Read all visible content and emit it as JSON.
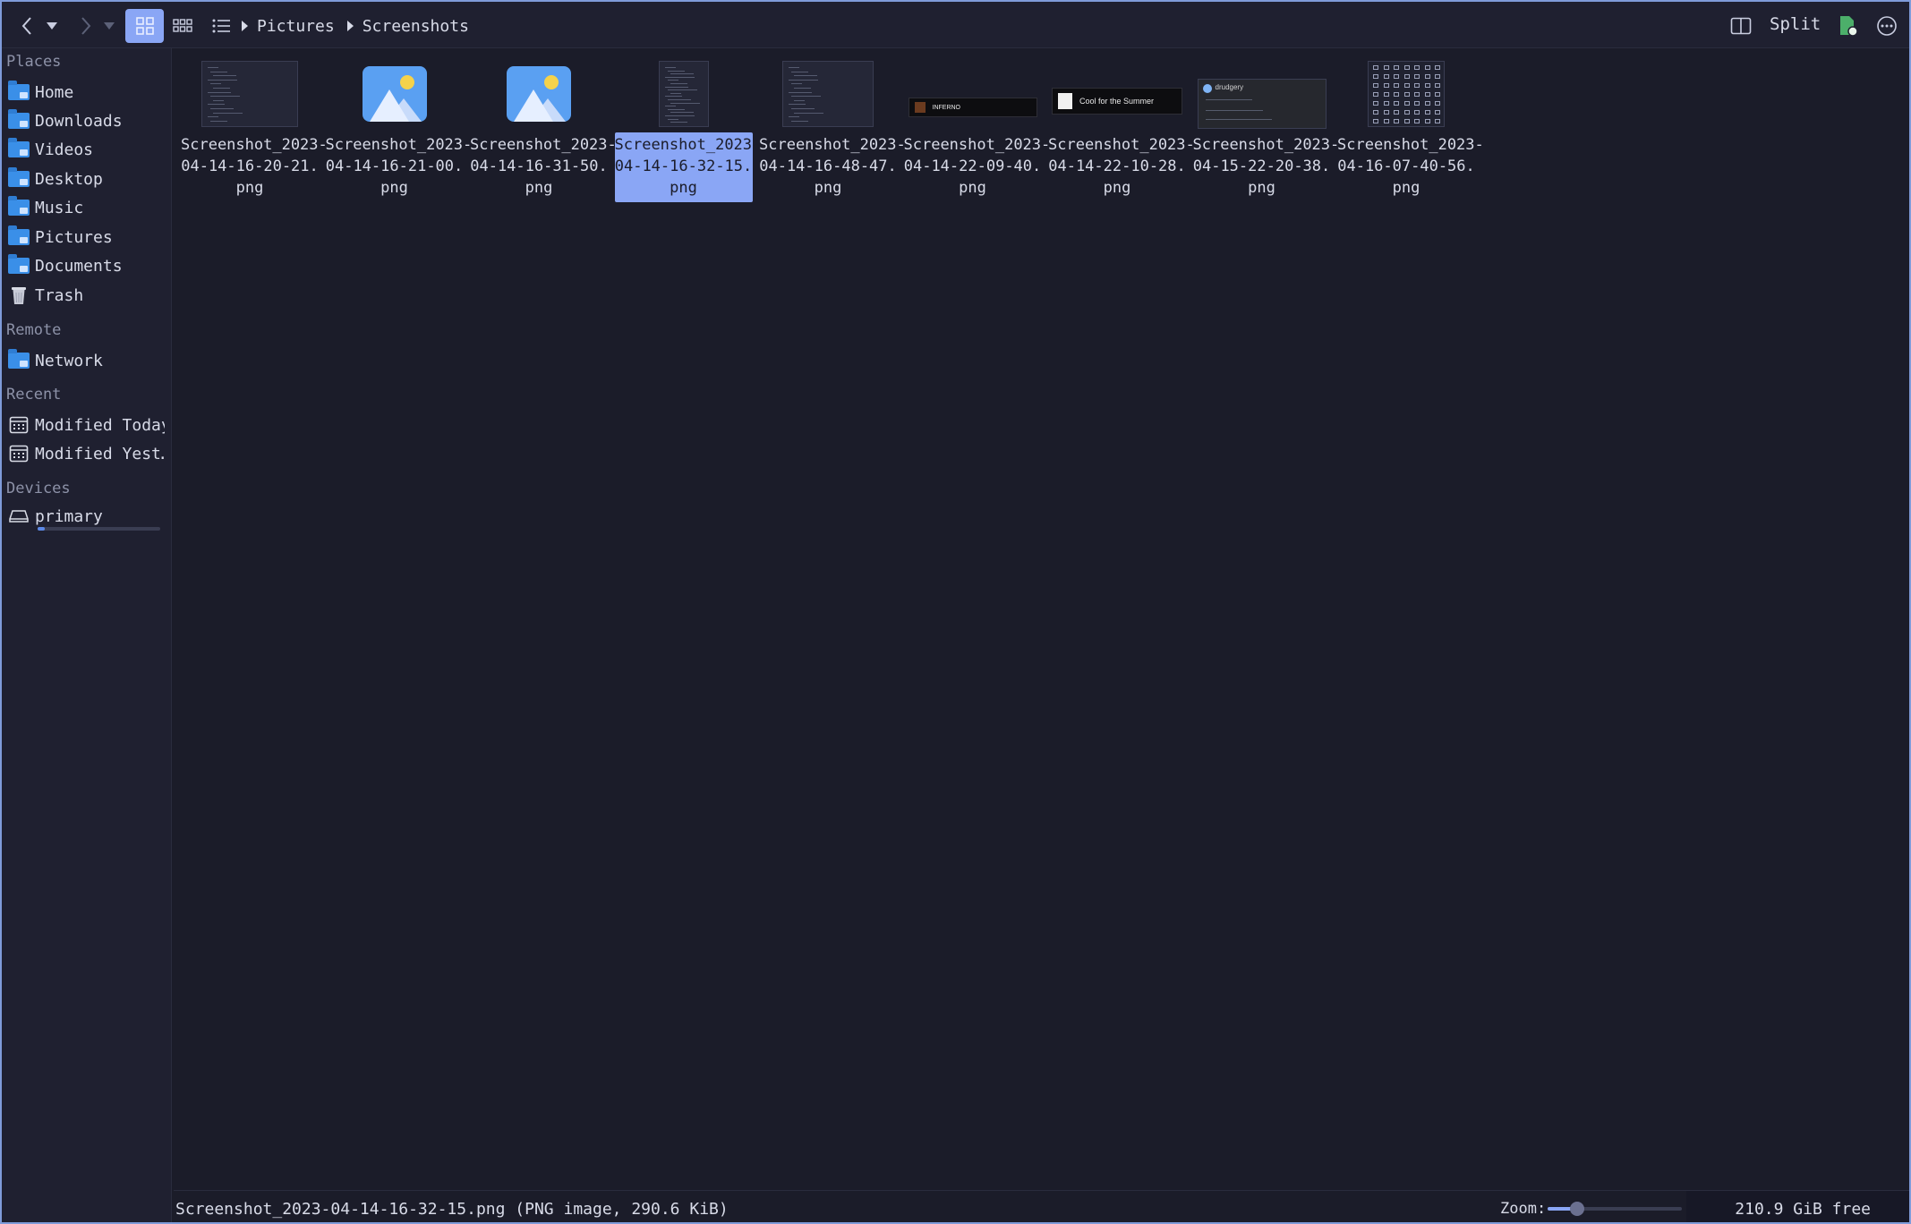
{
  "breadcrumb": [
    "Pictures",
    "Screenshots"
  ],
  "toolbar": {
    "split_label": "Split"
  },
  "sidebar": {
    "sections": [
      {
        "title": "Places",
        "items": [
          {
            "label": "Home",
            "icon": "home-folder-icon"
          },
          {
            "label": "Downloads",
            "icon": "downloads-folder-icon"
          },
          {
            "label": "Videos",
            "icon": "videos-folder-icon"
          },
          {
            "label": "Desktop",
            "icon": "desktop-folder-icon"
          },
          {
            "label": "Music",
            "icon": "music-folder-icon"
          },
          {
            "label": "Pictures",
            "icon": "pictures-folder-icon"
          },
          {
            "label": "Documents",
            "icon": "documents-folder-icon"
          },
          {
            "label": "Trash",
            "icon": "trash-icon"
          }
        ]
      },
      {
        "title": "Remote",
        "items": [
          {
            "label": "Network",
            "icon": "network-folder-icon"
          }
        ]
      },
      {
        "title": "Recent",
        "items": [
          {
            "label": "Modified Today",
            "icon": "calendar-icon"
          },
          {
            "label": "Modified Yest…",
            "icon": "calendar-icon"
          }
        ]
      },
      {
        "title": "Devices",
        "items": [
          {
            "label": "primary",
            "icon": "drive-icon",
            "usage_fraction": 0.06
          }
        ]
      }
    ]
  },
  "files": [
    {
      "line1": "Screenshot_2023-",
      "line2": "04-14-16-20-21.",
      "line3": "png",
      "thumb": "screenshot"
    },
    {
      "line1": "Screenshot_2023-",
      "line2": "04-14-16-21-00.",
      "line3": "png",
      "thumb": "image-icon"
    },
    {
      "line1": "Screenshot_2023-",
      "line2": "04-14-16-31-50.",
      "line3": "png",
      "thumb": "image-icon"
    },
    {
      "line1": "Screenshot_2023-",
      "line2": "04-14-16-32-15.",
      "line3": "png",
      "thumb": "screenshot-tall",
      "selected": true
    },
    {
      "line1": "Screenshot_2023-",
      "line2": "04-14-16-48-47.",
      "line3": "png",
      "thumb": "screenshot"
    },
    {
      "line1": "Screenshot_2023-",
      "line2": "04-14-22-09-40.",
      "line3": "png",
      "thumb": "banner",
      "banner_text": "INFERNO"
    },
    {
      "line1": "Screenshot_2023-",
      "line2": "04-14-22-10-28.",
      "line3": "png",
      "thumb": "banner",
      "banner_text": "Cool for the Summer"
    },
    {
      "line1": "Screenshot_2023-",
      "line2": "04-15-22-20-38.",
      "line3": "png",
      "thumb": "card",
      "banner_text": "drudgery"
    },
    {
      "line1": "Screenshot_2023-",
      "line2": "04-16-07-40-56.",
      "line3": "png",
      "thumb": "icons-grid"
    }
  ],
  "statusbar": {
    "selection_text": "Screenshot_2023-04-14-16-32-15.png (PNG image, 290.6 KiB)",
    "zoom_label": "Zoom:",
    "zoom_fraction": 0.22,
    "free_space": "210.9 GiB free"
  },
  "colors": {
    "accent": "#8aa6f5",
    "background": "#1b1c29",
    "sidebar": "#1f2030",
    "folder": "#3a8fe8"
  }
}
